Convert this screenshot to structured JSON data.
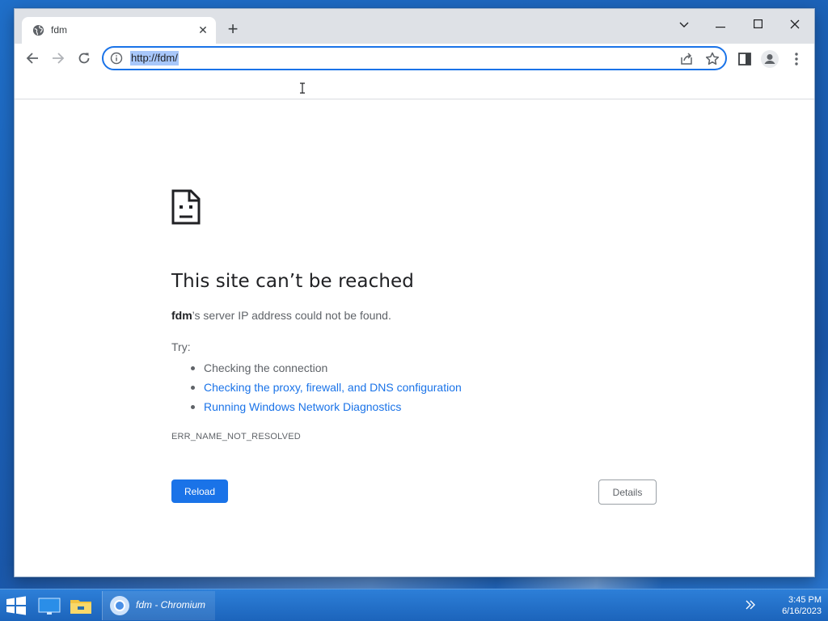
{
  "browser": {
    "tab": {
      "title": "fdm"
    },
    "address_bar": {
      "url": "http://fdm/"
    }
  },
  "error_page": {
    "title": "This site can’t be reached",
    "message_host": "fdm",
    "message_rest": "’s server IP address could not be found.",
    "try_label": "Try:",
    "suggestions": [
      "Checking the connection",
      "Checking the proxy, firewall, and DNS configuration",
      "Running Windows Network Diagnostics"
    ],
    "error_code": "ERR_NAME_NOT_RESOLVED",
    "reload_label": "Reload",
    "details_label": "Details"
  },
  "taskbar": {
    "active_window_label": "fdm - Chromium",
    "time": "3:45 PM",
    "date": "6/16/2023"
  },
  "colors": {
    "accent": "#1a73e8",
    "taskbar": "#1c64bb"
  }
}
